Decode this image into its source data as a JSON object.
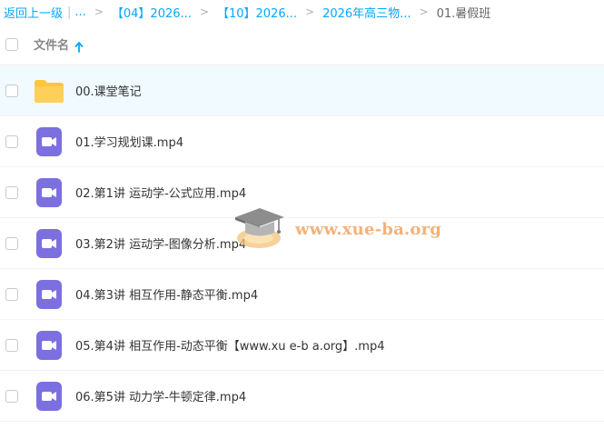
{
  "breadcrumb": {
    "back_label": "返回上一级",
    "bar": "|",
    "ellipsis": "...",
    "items": [
      "【04】2026...",
      "【10】2026...",
      "2026年高三物..."
    ],
    "current": "01.暑假班",
    "separator": ">"
  },
  "header": {
    "column_label": "文件名",
    "sort_icon": "arrow-up-icon",
    "accent_color": "#06a7ff"
  },
  "files": [
    {
      "name": "00.课堂笔记",
      "type": "folder-icon",
      "selected": true
    },
    {
      "name": "01.学习规划课.mp4",
      "type": "video-icon"
    },
    {
      "name": "02.第1讲 运动学-公式应用.mp4",
      "type": "video-icon"
    },
    {
      "name": "03.第2讲 运动学-图像分析.mp4",
      "type": "video-icon"
    },
    {
      "name": "04.第3讲 相互作用-静态平衡.mp4",
      "type": "video-icon"
    },
    {
      "name": "05.第4讲 相互作用-动态平衡【www.xu e-b a.org】.mp4",
      "type": "video-icon"
    },
    {
      "name": "06.第5讲 动力学-牛顿定律.mp4",
      "type": "video-icon"
    }
  ],
  "watermark": {
    "text": "www.xue-ba.org",
    "icon": "graduation-cap-logo",
    "color": "#f2b27a"
  },
  "colors": {
    "folder": "#ffc53d",
    "video": "#7c6fe0",
    "selected_row": "#f0faff"
  }
}
